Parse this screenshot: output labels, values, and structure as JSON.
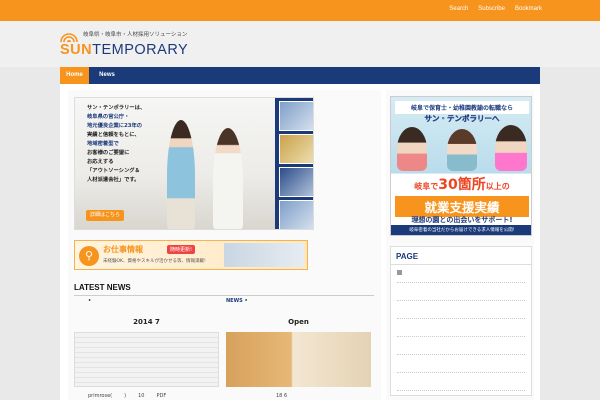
{
  "topbar": {
    "links": [
      "Search",
      "Subscribe",
      "Bookmark"
    ]
  },
  "header": {
    "tagline": "岐阜県・岐阜市・人材採用ソリューション",
    "brand_sun": "SUN",
    "brand_rest": "TEMPORARY"
  },
  "nav": {
    "items": [
      {
        "label": "Home"
      },
      {
        "label": "News"
      }
    ]
  },
  "hero": {
    "lines": [
      "サン・テンポラリーは、",
      "岐阜県の官公庁・",
      "地元優良企業に23年の",
      "実績と信頼をもとに、",
      "地域密着型で",
      "お客様のご要望に",
      "お応えする",
      "「アウトソーシング＆",
      "人材派遣会社」です。"
    ],
    "button": "詳細はこちら"
  },
  "recruit": {
    "title": "お仕事情報",
    "badge": "随時更新!",
    "sub": "未経験OK、資格やスキルが活かせる等、情報満載!"
  },
  "latest_news": {
    "title": "LATEST NEWS",
    "columns": [
      {
        "category": "•",
        "title": "2014  7",
        "meta": [
          "primrose(",
          ")",
          "10",
          "PDF"
        ]
      },
      {
        "category": "NEWS •",
        "title": "Open",
        "meta": [
          "",
          "",
          "18 6",
          ""
        ]
      }
    ]
  },
  "banner": {
    "line1": "岐阜で保育士・幼稚園教諭の転職なら",
    "line2": "サン・テンポラリーへ",
    "line3_pre": "岐阜で",
    "line3_num": "30箇所",
    "line3_post": "以上の",
    "line4": "就業支援実績",
    "line5": "理想の園との出会いをサポート!",
    "line6": "岐阜密着の当社だからお届けできる求人情報を公開!"
  },
  "page_widget": {
    "title": "PAGE",
    "items": 7
  },
  "colors": {
    "accent": "#f7941d",
    "brand": "#1b3a7a"
  }
}
